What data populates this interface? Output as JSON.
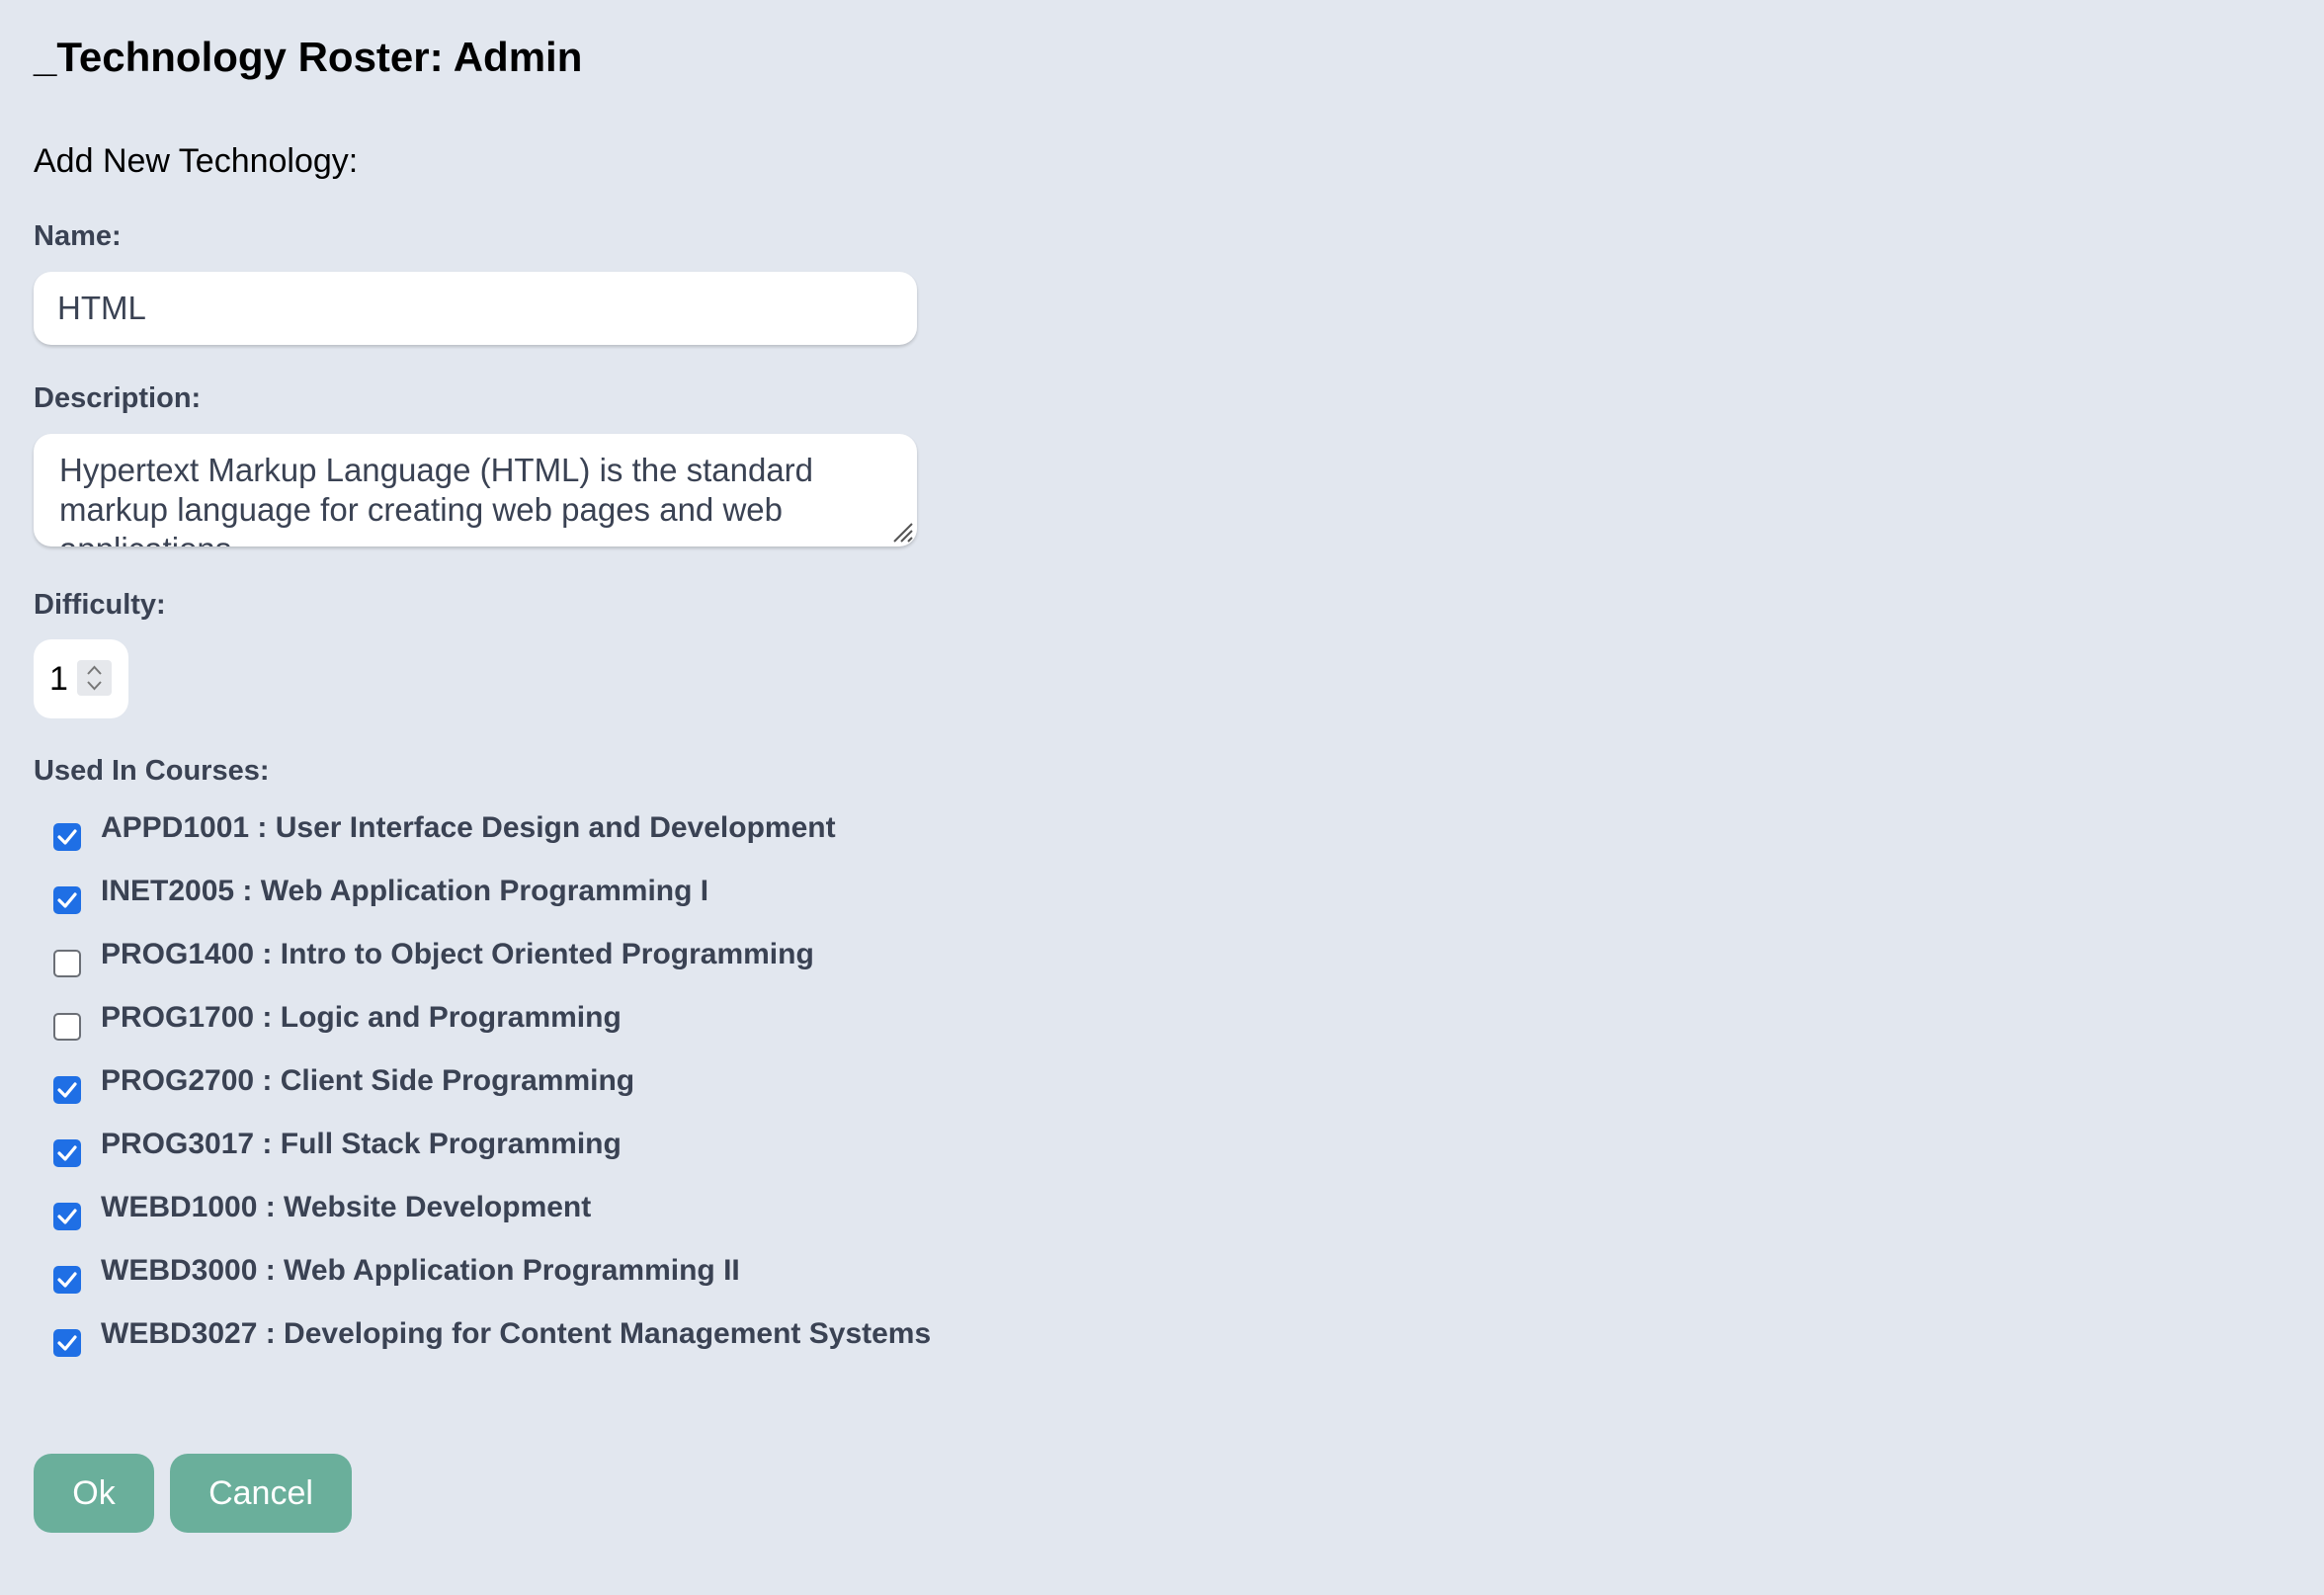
{
  "header": {
    "title": "_Technology Roster: Admin"
  },
  "form": {
    "heading": "Add New Technology:",
    "name_label": "Name:",
    "name_value": "HTML",
    "description_label": "Description:",
    "description_value": "Hypertext Markup Language (HTML) is the standard markup language for creating web pages and web applications.",
    "difficulty_label": "Difficulty:",
    "difficulty_value": "1",
    "courses_label": "Used In Courses:",
    "courses": [
      {
        "label": "APPD1001 : User Interface Design and Development",
        "checked": true
      },
      {
        "label": "INET2005 : Web Application Programming I",
        "checked": true
      },
      {
        "label": "PROG1400 : Intro to Object Oriented Programming",
        "checked": false
      },
      {
        "label": "PROG1700 : Logic and Programming",
        "checked": false
      },
      {
        "label": "PROG2700 : Client Side Programming",
        "checked": true
      },
      {
        "label": "PROG3017 : Full Stack Programming",
        "checked": true
      },
      {
        "label": "WEBD1000 : Website Development",
        "checked": true
      },
      {
        "label": "WEBD3000 : Web Application Programming II",
        "checked": true
      },
      {
        "label": "WEBD3027 : Developing for Content Management Systems",
        "checked": true
      }
    ]
  },
  "buttons": {
    "ok_label": "Ok",
    "cancel_label": "Cancel"
  },
  "colors": {
    "background": "#e2e7ef",
    "button": "#6aaf9b",
    "checkbox_checked": "#1f6fe5",
    "label_text": "#3a4253"
  },
  "icons": {
    "checkmark": "checkmark-icon",
    "resize": "resize-handle-icon",
    "stepper_up": "chevron-up-icon",
    "stepper_down": "chevron-down-icon"
  }
}
